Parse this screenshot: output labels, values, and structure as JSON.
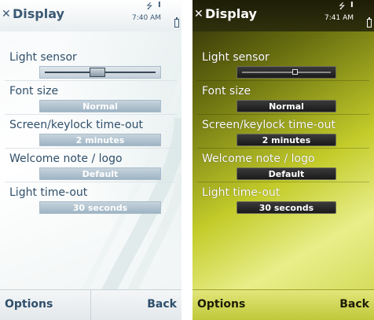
{
  "status": {
    "left_time": "7:40 AM",
    "right_time": "7:41 AM"
  },
  "header": {
    "title": "Display"
  },
  "settings": [
    {
      "label": "Light sensor",
      "type": "slider",
      "level": 0.45
    },
    {
      "label": "Font size",
      "value": "Normal"
    },
    {
      "label": "Screen/keylock time-out",
      "value": "2 minutes"
    },
    {
      "label": "Welcome note / logo",
      "value": "Default"
    },
    {
      "label": "Light time-out",
      "value": "30 seconds"
    }
  ],
  "softkeys": {
    "left": "Options",
    "right": "Back"
  },
  "icons": {
    "usb": "usb-icon",
    "signal": "signal-bar-icon",
    "battery": "battery-icon",
    "close": "close-icon"
  },
  "colors": {
    "light_theme_text": "#2f4f6b",
    "light_theme_value_bg": "#a9bccb",
    "dark_theme_value_bg": "#1a1a1a",
    "dark_theme_accent": "#c3cc2a"
  }
}
